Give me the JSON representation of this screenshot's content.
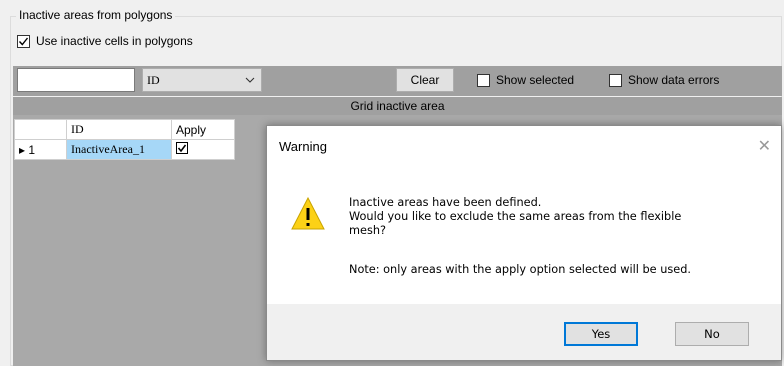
{
  "group": {
    "title": "Inactive areas from polygons"
  },
  "use_inactive": {
    "label": "Use inactive cells in polygons",
    "checked": "☑"
  },
  "toolbar": {
    "filter_value": "",
    "column_select": "ID",
    "column_chevron": "﹀",
    "clear_label": "Clear",
    "show_selected_label": "Show selected",
    "show_errors_label": "Show data errors"
  },
  "grid": {
    "title": "Grid inactive area",
    "headers": {
      "rowhead": "",
      "id": "ID",
      "apply": "Apply"
    },
    "rows": [
      {
        "marker": "▸ 1",
        "id": "InactiveArea_1",
        "apply": "☑"
      }
    ]
  },
  "dialog": {
    "title": "Warning",
    "close": "✕",
    "line1": "Inactive areas have been defined.",
    "line2": "Would you like to exclude the same areas from the flexible",
    "line3": "mesh?",
    "note": "Note: only areas with the apply option selected will be used.",
    "yes_label": "Yes",
    "no_label": "No"
  },
  "colors": {
    "accent": "#0078d7",
    "warning": "#fcd116",
    "grid_bg": "#a9a9a9",
    "selection": "#a6d7f7"
  }
}
